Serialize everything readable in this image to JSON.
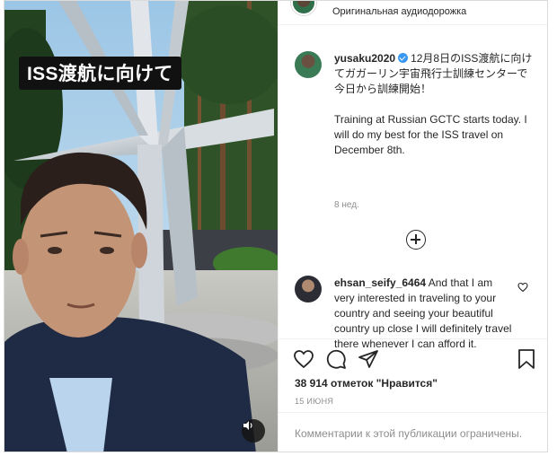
{
  "media": {
    "overlay_caption": "ISS渡航に向けて"
  },
  "header": {
    "audio_label": "Оригинальная аудиодорожка"
  },
  "post": {
    "username": "yusaku2020",
    "caption_ja": "12月8日のISS渡航に向けてガガーリン宇宙飛行士訓練センターで今日から訓練開始！",
    "caption_en": "Training at Russian GCTC starts today. I will do my best for the ISS travel on December 8th.",
    "time_ago": "8 нед."
  },
  "comment": {
    "username": "ehsan_seify_6464",
    "text": "And that I am very interested in traveling to your country and seeing your beautiful country up close I will definitely travel there whenever I can afford it."
  },
  "stats": {
    "likes": "38 914 отметок \"Нравится\"",
    "date": "15 ИЮНЯ"
  },
  "footer": {
    "comments_limited": "Комментарии к этой публикации ограничены."
  },
  "icons": [
    "speaker-icon",
    "heart-icon",
    "comment-icon",
    "share-icon",
    "bookmark-icon",
    "plus-circle-icon",
    "verified-icon"
  ]
}
